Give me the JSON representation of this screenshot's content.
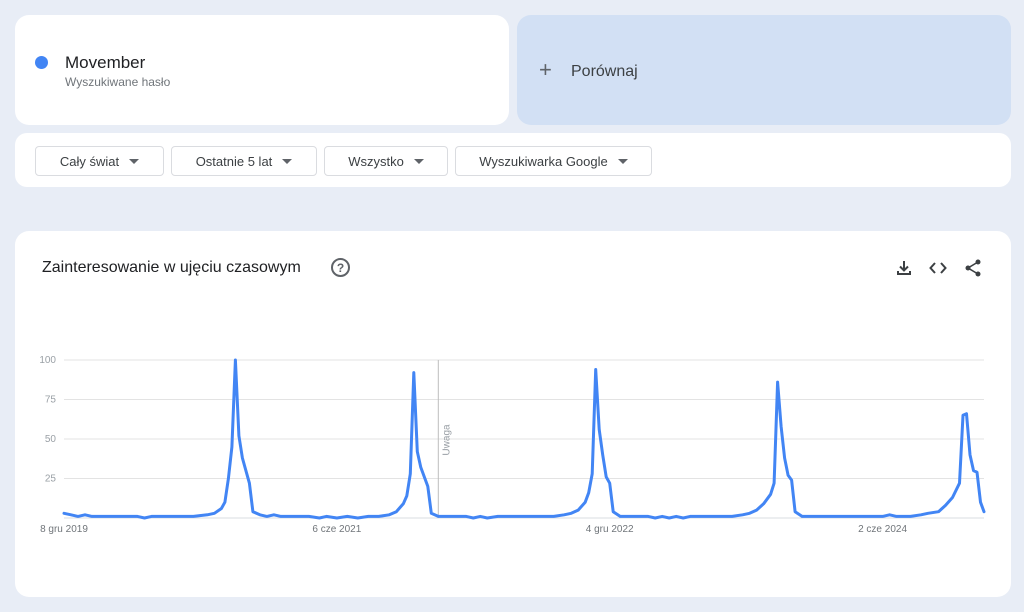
{
  "term": {
    "name": "Movember",
    "type_label": "Wyszukiwane hasło",
    "color": "#4285f4"
  },
  "compare": {
    "plus": "+",
    "label": "Porównaj"
  },
  "filters": [
    {
      "label": "Cały świat"
    },
    {
      "label": "Ostatnie 5 lat"
    },
    {
      "label": "Wszystko"
    },
    {
      "label": "Wyszukiwarka Google"
    }
  ],
  "chart_section": {
    "title": "Zainteresowanie w ujęciu czasowym",
    "help_glyph": "?",
    "icons": [
      "download-icon",
      "embed-code-icon",
      "share-icon"
    ]
  },
  "chart_data": {
    "type": "line",
    "title": "",
    "xlabel": "",
    "ylabel": "",
    "ylim": [
      0,
      100
    ],
    "yticks": [
      25,
      50,
      75,
      100
    ],
    "grid": true,
    "line_color": "#4285f4",
    "xtick_labels": [
      {
        "x": "2019-12-08",
        "label": "8 gru 2019"
      },
      {
        "x": "2021-06-06",
        "label": "6 cze 2021"
      },
      {
        "x": "2022-12-04",
        "label": "4 gru 2022"
      },
      {
        "x": "2024-06-02",
        "label": "2 cze 2024"
      }
    ],
    "annotation": {
      "x": "2021-12-26",
      "label": "Uwaga"
    },
    "series": [
      {
        "points": [
          [
            "2019-12-08",
            3
          ],
          [
            "2019-12-22",
            2
          ],
          [
            "2020-01-05",
            1
          ],
          [
            "2020-01-19",
            2
          ],
          [
            "2020-02-02",
            1
          ],
          [
            "2020-03-01",
            1
          ],
          [
            "2020-04-05",
            1
          ],
          [
            "2020-05-03",
            1
          ],
          [
            "2020-05-17",
            0
          ],
          [
            "2020-05-31",
            1
          ],
          [
            "2020-06-28",
            1
          ],
          [
            "2020-07-26",
            1
          ],
          [
            "2020-08-23",
            1
          ],
          [
            "2020-09-20",
            2
          ],
          [
            "2020-10-04",
            3
          ],
          [
            "2020-10-18",
            6
          ],
          [
            "2020-10-25",
            10
          ],
          [
            "2020-11-01",
            25
          ],
          [
            "2020-11-08",
            45
          ],
          [
            "2020-11-15",
            100
          ],
          [
            "2020-11-22",
            52
          ],
          [
            "2020-11-29",
            38
          ],
          [
            "2020-12-06",
            30
          ],
          [
            "2020-12-13",
            22
          ],
          [
            "2020-12-20",
            4
          ],
          [
            "2021-01-03",
            2
          ],
          [
            "2021-01-17",
            1
          ],
          [
            "2021-01-31",
            2
          ],
          [
            "2021-02-14",
            1
          ],
          [
            "2021-03-14",
            1
          ],
          [
            "2021-04-11",
            1
          ],
          [
            "2021-05-02",
            0
          ],
          [
            "2021-05-16",
            1
          ],
          [
            "2021-06-06",
            0
          ],
          [
            "2021-06-27",
            1
          ],
          [
            "2021-07-18",
            0
          ],
          [
            "2021-08-08",
            1
          ],
          [
            "2021-08-29",
            1
          ],
          [
            "2021-09-19",
            2
          ],
          [
            "2021-10-03",
            4
          ],
          [
            "2021-10-17",
            9
          ],
          [
            "2021-10-24",
            14
          ],
          [
            "2021-10-31",
            28
          ],
          [
            "2021-11-07",
            92
          ],
          [
            "2021-11-14",
            42
          ],
          [
            "2021-11-21",
            32
          ],
          [
            "2021-11-28",
            26
          ],
          [
            "2021-12-05",
            20
          ],
          [
            "2021-12-12",
            3
          ],
          [
            "2021-12-26",
            1
          ],
          [
            "2022-01-23",
            1
          ],
          [
            "2022-02-20",
            1
          ],
          [
            "2022-03-06",
            0
          ],
          [
            "2022-03-20",
            1
          ],
          [
            "2022-04-03",
            0
          ],
          [
            "2022-04-24",
            1
          ],
          [
            "2022-05-22",
            1
          ],
          [
            "2022-06-19",
            1
          ],
          [
            "2022-07-17",
            1
          ],
          [
            "2022-08-14",
            1
          ],
          [
            "2022-09-04",
            2
          ],
          [
            "2022-09-18",
            3
          ],
          [
            "2022-10-02",
            5
          ],
          [
            "2022-10-16",
            10
          ],
          [
            "2022-10-23",
            16
          ],
          [
            "2022-10-30",
            28
          ],
          [
            "2022-11-06",
            94
          ],
          [
            "2022-11-13",
            56
          ],
          [
            "2022-11-20",
            40
          ],
          [
            "2022-11-27",
            26
          ],
          [
            "2022-12-04",
            22
          ],
          [
            "2022-12-11",
            4
          ],
          [
            "2022-12-25",
            1
          ],
          [
            "2023-01-22",
            1
          ],
          [
            "2023-02-19",
            1
          ],
          [
            "2023-03-05",
            0
          ],
          [
            "2023-03-19",
            1
          ],
          [
            "2023-04-02",
            0
          ],
          [
            "2023-04-16",
            1
          ],
          [
            "2023-04-30",
            0
          ],
          [
            "2023-05-14",
            1
          ],
          [
            "2023-06-11",
            1
          ],
          [
            "2023-07-09",
            1
          ],
          [
            "2023-08-06",
            1
          ],
          [
            "2023-08-27",
            2
          ],
          [
            "2023-09-10",
            3
          ],
          [
            "2023-09-24",
            5
          ],
          [
            "2023-10-08",
            9
          ],
          [
            "2023-10-22",
            15
          ],
          [
            "2023-10-29",
            22
          ],
          [
            "2023-11-05",
            86
          ],
          [
            "2023-11-12",
            58
          ],
          [
            "2023-11-19",
            38
          ],
          [
            "2023-11-26",
            27
          ],
          [
            "2023-12-03",
            24
          ],
          [
            "2023-12-10",
            4
          ],
          [
            "2023-12-24",
            1
          ],
          [
            "2024-01-21",
            1
          ],
          [
            "2024-02-18",
            1
          ],
          [
            "2024-03-17",
            1
          ],
          [
            "2024-04-14",
            1
          ],
          [
            "2024-05-12",
            1
          ],
          [
            "2024-06-02",
            1
          ],
          [
            "2024-06-16",
            2
          ],
          [
            "2024-06-30",
            1
          ],
          [
            "2024-07-28",
            1
          ],
          [
            "2024-08-18",
            2
          ],
          [
            "2024-09-01",
            3
          ],
          [
            "2024-09-22",
            4
          ],
          [
            "2024-10-06",
            8
          ],
          [
            "2024-10-20",
            13
          ],
          [
            "2024-11-03",
            22
          ],
          [
            "2024-11-10",
            65
          ],
          [
            "2024-11-17",
            66
          ],
          [
            "2024-11-24",
            40
          ],
          [
            "2024-12-01",
            30
          ],
          [
            "2024-12-08",
            29
          ],
          [
            "2024-12-15",
            10
          ],
          [
            "2024-12-22",
            4
          ]
        ]
      }
    ]
  }
}
